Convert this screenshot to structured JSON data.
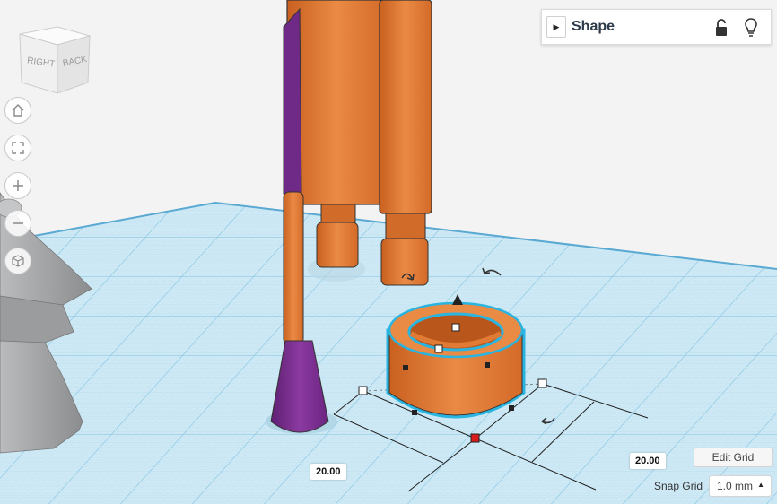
{
  "viewcube": {
    "face_right": "RIGHT",
    "face_back": "BACK"
  },
  "nav_buttons": [
    {
      "name": "home-view-button",
      "icon": "home-icon"
    },
    {
      "name": "fit-view-button",
      "icon": "fit-all-icon"
    },
    {
      "name": "zoom-in-button",
      "icon": "plus-icon"
    },
    {
      "name": "zoom-out-button",
      "icon": "minus-icon"
    },
    {
      "name": "projection-button",
      "icon": "cube-icon"
    }
  ],
  "shape_panel": {
    "title": "Shape"
  },
  "dimensions": {
    "width": "20.00",
    "depth": "20.00"
  },
  "grid": {
    "edit_label": "Edit Grid",
    "snap_label": "Snap Grid",
    "snap_value": "1.0 mm"
  },
  "colors": {
    "shape_orange": "#e07a35",
    "shape_purple": "#7a2e8e",
    "selection_cyan": "#2ab4e0",
    "grid_blue": "#8ccbe6",
    "shape_gray": "#a4a6a8"
  }
}
